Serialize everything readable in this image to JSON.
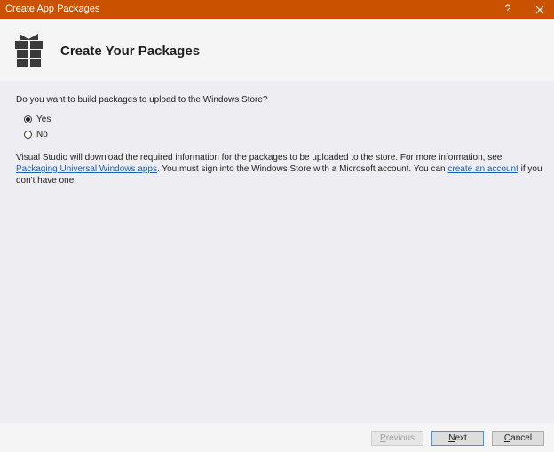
{
  "window": {
    "title": "Create App Packages",
    "help_glyph": "?"
  },
  "header": {
    "title": "Create Your Packages"
  },
  "main": {
    "question": "Do you want to build packages to upload to the Windows Store?",
    "options": [
      {
        "label": "Yes",
        "checked": true
      },
      {
        "label": "No",
        "checked": false
      }
    ],
    "info": {
      "part1": "Visual Studio will download the required information for the packages to be uploaded to the store. For more information, see ",
      "link1": "Packaging Universal Windows apps",
      "part2": ". You must sign into the Windows Store with a Microsoft account. You can ",
      "link2": "create an account",
      "part3": " if you don't have one."
    }
  },
  "footer": {
    "previous": {
      "first": "P",
      "rest": "revious",
      "enabled": false
    },
    "next": {
      "first": "N",
      "rest": "ext",
      "enabled": true
    },
    "cancel": {
      "first": "C",
      "rest": "ancel",
      "enabled": true
    }
  },
  "colors": {
    "titlebar": "#ca5100",
    "link": "#1a5fb4",
    "default_button_border": "#3399ff"
  },
  "icons": {
    "header": "gift-package-icon",
    "close": "close-icon"
  }
}
